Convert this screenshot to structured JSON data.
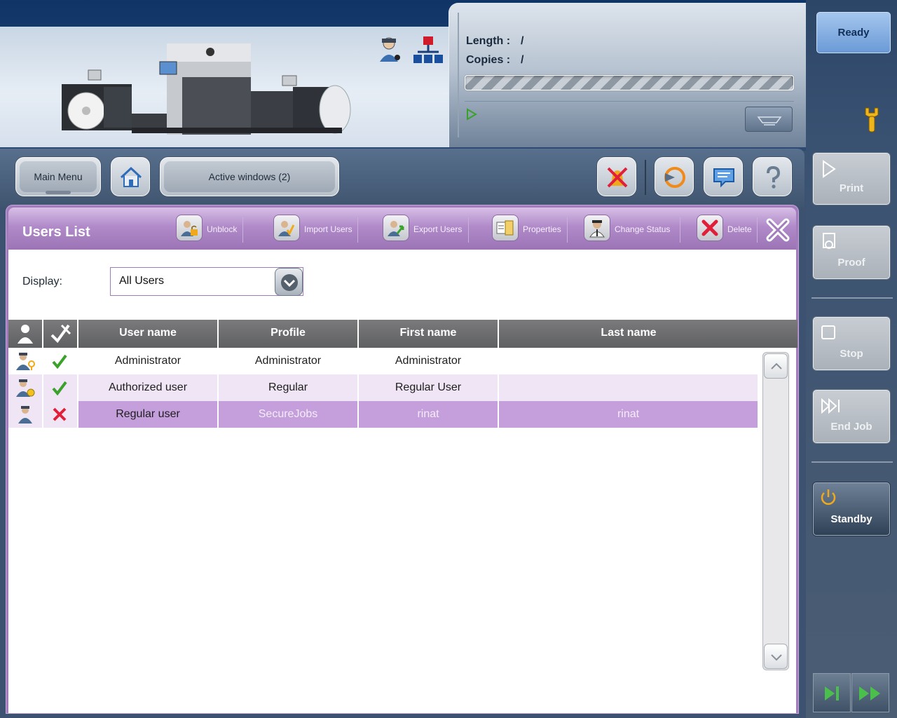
{
  "status": {
    "length_label": "Length :",
    "length_value": "/",
    "copies_label": "Copies :",
    "copies_value": "/",
    "progress": 0,
    "ready_label": "Ready"
  },
  "toolbar": {
    "main_menu_label": "Main Menu",
    "active_windows_label": "Active windows (2)"
  },
  "rail": {
    "print_label": "Print",
    "proof_label": "Proof",
    "stop_label": "Stop",
    "end_job_label": "End Job",
    "standby_label": "Standby"
  },
  "panel": {
    "title": "Users List",
    "actions": {
      "unblock": "Unblock",
      "import_users": "Import Users",
      "export_users": "Export Users",
      "properties": "Properties",
      "change_status": "Change Status",
      "delete": "Delete"
    },
    "display_label": "Display:",
    "display_value": "All Users"
  },
  "table": {
    "columns": [
      "User name",
      "Profile",
      "First name",
      "Last name"
    ],
    "rows": [
      {
        "role_icon": "admin-user-icon",
        "active": true,
        "user_name": "Administrator",
        "profile": "Administrator",
        "first_name": "Administrator",
        "last_name": ""
      },
      {
        "role_icon": "authorized-user-icon",
        "active": true,
        "user_name": "Authorized user",
        "profile": "Regular",
        "first_name": "Regular User",
        "last_name": ""
      },
      {
        "role_icon": "regular-user-icon",
        "active": false,
        "user_name": "Regular user",
        "profile": "SecureJobs",
        "first_name": "rinat",
        "last_name": "rinat"
      }
    ],
    "selected_row": 2
  },
  "colors": {
    "accent_purple": "#a27cbc",
    "row_alt": "#efe5f4",
    "row_selected": "#c59fdc",
    "check_green": "#3aa12a",
    "cross_red": "#e0203a",
    "ready_blue": "#6a9ad6"
  }
}
